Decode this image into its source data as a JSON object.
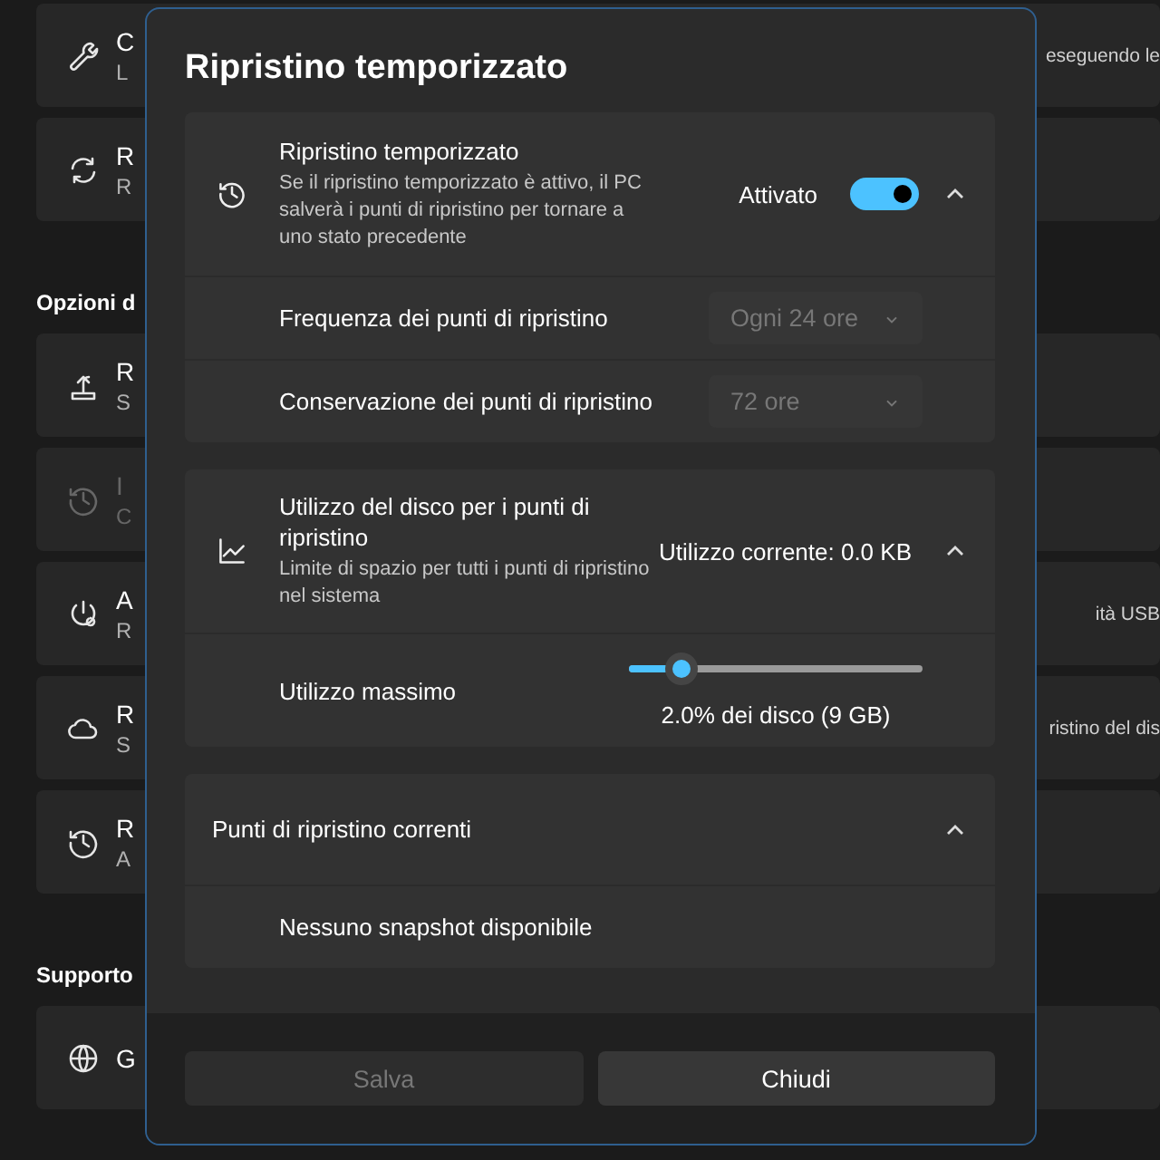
{
  "background": {
    "items": [
      {
        "kind": "card",
        "title": "C",
        "subtitle": "L",
        "right_text": "eseguendo le",
        "disabled": false
      },
      {
        "kind": "card",
        "title": "R",
        "subtitle": "R",
        "disabled": false
      },
      {
        "kind": "header",
        "title": "Opzioni d"
      },
      {
        "kind": "card",
        "title": "R",
        "subtitle": "S",
        "disabled": false
      },
      {
        "kind": "card",
        "title": "I",
        "subtitle": "C",
        "disabled": true
      },
      {
        "kind": "card",
        "title": "A",
        "subtitle": "R",
        "right_text": "ità USB",
        "disabled": false
      },
      {
        "kind": "card",
        "title": "R",
        "subtitle": "S",
        "right_text": "ristino del dis",
        "disabled": false
      },
      {
        "kind": "card",
        "title": "R",
        "subtitle": "A",
        "disabled": false
      },
      {
        "kind": "header",
        "title": "Supporto"
      },
      {
        "kind": "card",
        "title": "G",
        "disabled": false
      }
    ]
  },
  "dialog": {
    "title": "Ripristino temporizzato",
    "sections": [
      {
        "title": "Ripristino temporizzato",
        "description": "Se il ripristino temporizzato è attivo, il PC salverà i punti di ripristino per tornare a uno stato precedente",
        "status": "Attivato",
        "toggle_on": true,
        "expanded": true,
        "rows": [
          {
            "kind": "dropdown",
            "label": "Frequenza dei punti di ripristino",
            "value": "Ogni 24 ore",
            "disabled": true
          },
          {
            "kind": "dropdown",
            "label": "Conservazione dei punti di ripristino",
            "value": "72 ore",
            "disabled": true
          }
        ]
      },
      {
        "title": "Utilizzo del disco per i punti di ripristino",
        "description": "Limite di spazio per tutti i punti di ripristino nel sistema",
        "status": "Utilizzo corrente: 0.0 KB",
        "expanded": true,
        "rows": [
          {
            "kind": "slider",
            "label": "Utilizzo massimo",
            "level": 0.18,
            "reading": "2.0% dei disco (9 GB)"
          }
        ]
      },
      {
        "title": "Punti di ripristino correnti",
        "expanded": true,
        "rows": [
          {
            "kind": "text",
            "label": "Nessuno snapshot disponibile"
          }
        ]
      }
    ],
    "buttons": [
      {
        "label": "Salva",
        "disabled": true
      },
      {
        "label": "Chiudi",
        "disabled": false
      }
    ]
  }
}
